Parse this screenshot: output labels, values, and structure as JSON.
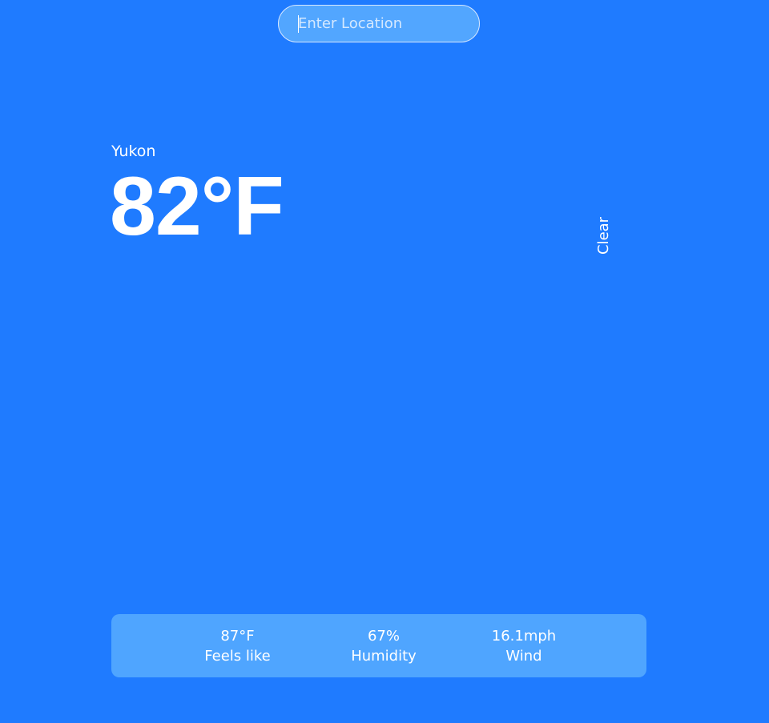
{
  "search": {
    "placeholder": "Enter Location",
    "value": ""
  },
  "weather": {
    "location": "Yukon",
    "temperature": "82°F",
    "condition": "Clear"
  },
  "stats": [
    {
      "value": "87°F",
      "label": "Feels like"
    },
    {
      "value": "67%",
      "label": "Humidity"
    },
    {
      "value": "16.1mph",
      "label": "Wind"
    }
  ],
  "colors": {
    "background": "#1f7bff",
    "input_background": "#52a6ff",
    "stats_background": "#4fa5ff",
    "text": "#ffffff"
  }
}
